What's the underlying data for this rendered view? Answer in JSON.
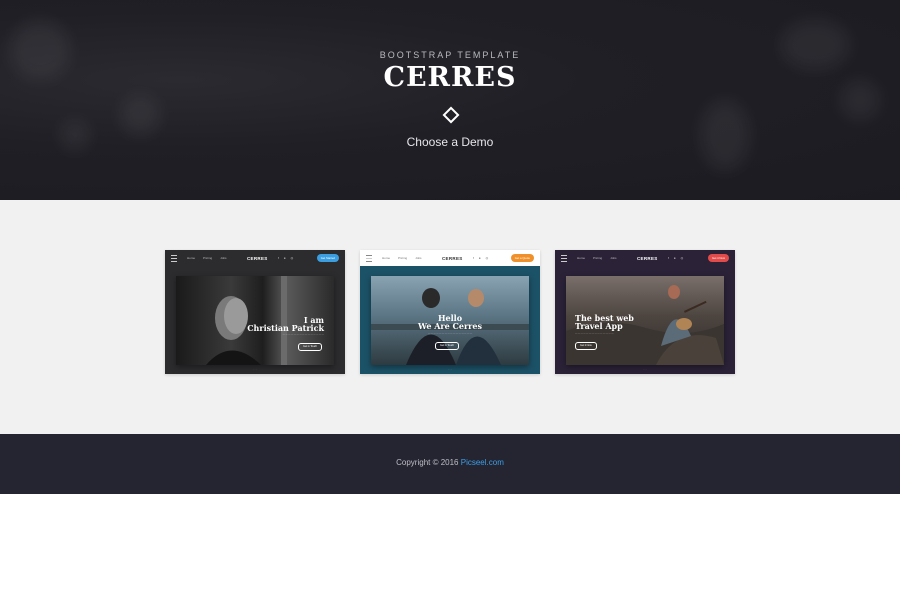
{
  "hero": {
    "subtitle": "BOOTSTRAP TEMPLATE",
    "title": "CERRES",
    "choose_label": "Choose a Demo"
  },
  "demos": [
    {
      "logo": "CERRES",
      "nav_links": [
        "Home",
        "Pricing",
        "Jobs"
      ],
      "cta_label": "Get Started",
      "headline_line1": "I am",
      "headline_line2": "Christian Patrick",
      "button_label": "Get in Touch",
      "colors": {
        "frame": "#2c2c2e",
        "cta": "#3b9ee0"
      }
    },
    {
      "logo": "CERRES",
      "nav_links": [
        "Home",
        "Pricing",
        "Jobs"
      ],
      "cta_label": "Get a Quote",
      "headline_line1": "Hello",
      "headline_line2": "We Are Cerres",
      "button_label": "Get in Touch",
      "colors": {
        "frame": "#1c5267",
        "cta": "#f0902a"
      }
    },
    {
      "logo": "CERRES",
      "nav_links": [
        "Home",
        "Pricing",
        "Jobs"
      ],
      "cta_label": "Get it Now",
      "headline_line1": "The best web",
      "headline_line2": "Travel App",
      "button_label": "Get it Now",
      "colors": {
        "frame": "#2b2238",
        "cta": "#e34a4a"
      }
    }
  ],
  "footer": {
    "copyright": "Copyright © 2016",
    "link": "Picseel.com"
  }
}
